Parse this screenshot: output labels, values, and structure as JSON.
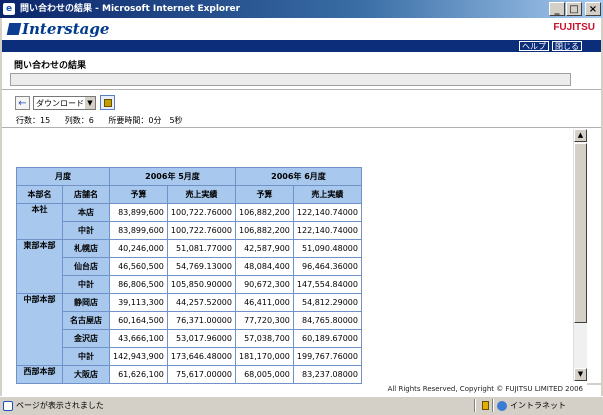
{
  "window": {
    "title": "問い合わせの結果 - Microsoft Internet Explorer",
    "minimize": "_",
    "maximize": "□",
    "close": "×"
  },
  "header": {
    "logo": "Interstage",
    "brand": "FUJITSU",
    "help_label": "ヘルプ",
    "close_label": "閉じる"
  },
  "page": {
    "section_title": "問い合わせの結果",
    "download_label": "ダウンロード",
    "meta": {
      "rows": "行数：15",
      "cols": "列数：6",
      "elapsed": "所要時間：0分　5秒"
    }
  },
  "table": {
    "month_header": "月度",
    "period1": "2006年 5月度",
    "period2": "2006年 6月度",
    "col_dept": "本部名",
    "col_store": "店舗名",
    "col_budget": "予算",
    "col_sales": "売上実績",
    "groups": [
      {
        "dept": "本社",
        "rows": [
          {
            "store": "本店",
            "b5": "83,899,600",
            "s5": "100,722.76000",
            "b6": "106,882,200",
            "s6": "122,140.74000"
          },
          {
            "store": "中計",
            "b5": "83,899,600",
            "s5": "100,722.76000",
            "b6": "106,882,200",
            "s6": "122,140.74000"
          }
        ]
      },
      {
        "dept": "東部本部",
        "rows": [
          {
            "store": "札幌店",
            "b5": "40,246,000",
            "s5": "51,081.77000",
            "b6": "42,587,900",
            "s6": "51,090.48000"
          },
          {
            "store": "仙台店",
            "b5": "46,560,500",
            "s5": "54,769.13000",
            "b6": "48,084,400",
            "s6": "96,464.36000"
          },
          {
            "store": "中計",
            "b5": "86,806,500",
            "s5": "105,850.90000",
            "b6": "90,672,300",
            "s6": "147,554.84000"
          }
        ]
      },
      {
        "dept": "中部本部",
        "rows": [
          {
            "store": "静岡店",
            "b5": "39,113,300",
            "s5": "44,257.52000",
            "b6": "46,411,000",
            "s6": "54,812.29000"
          },
          {
            "store": "名古屋店",
            "b5": "60,164,500",
            "s5": "76,371.00000",
            "b6": "77,720,300",
            "s6": "84,765.80000"
          },
          {
            "store": "金沢店",
            "b5": "43,666,100",
            "s5": "53,017.96000",
            "b6": "57,038,700",
            "s6": "60,189.67000"
          },
          {
            "store": "中計",
            "b5": "142,943,900",
            "s5": "173,646.48000",
            "b6": "181,170,000",
            "s6": "199,767.76000"
          }
        ]
      },
      {
        "dept": "西部本部",
        "rows": [
          {
            "store": "大阪店",
            "b5": "61,626,100",
            "s5": "75,617.00000",
            "b6": "68,005,000",
            "s6": "83,237.08000"
          }
        ]
      }
    ]
  },
  "footer": {
    "copyright": "All Rights Reserved, Copyright © FUJITSU LIMITED 2006"
  },
  "statusbar": {
    "status": "ページが表示されました",
    "zone": "イントラネット"
  },
  "colors": {
    "title_bar": "#0a246a",
    "nav_bar": "#0b2d7a",
    "header_cell": "#a9c8ee",
    "grid_border": "#6f92c8",
    "brand_red": "#c8102e"
  }
}
